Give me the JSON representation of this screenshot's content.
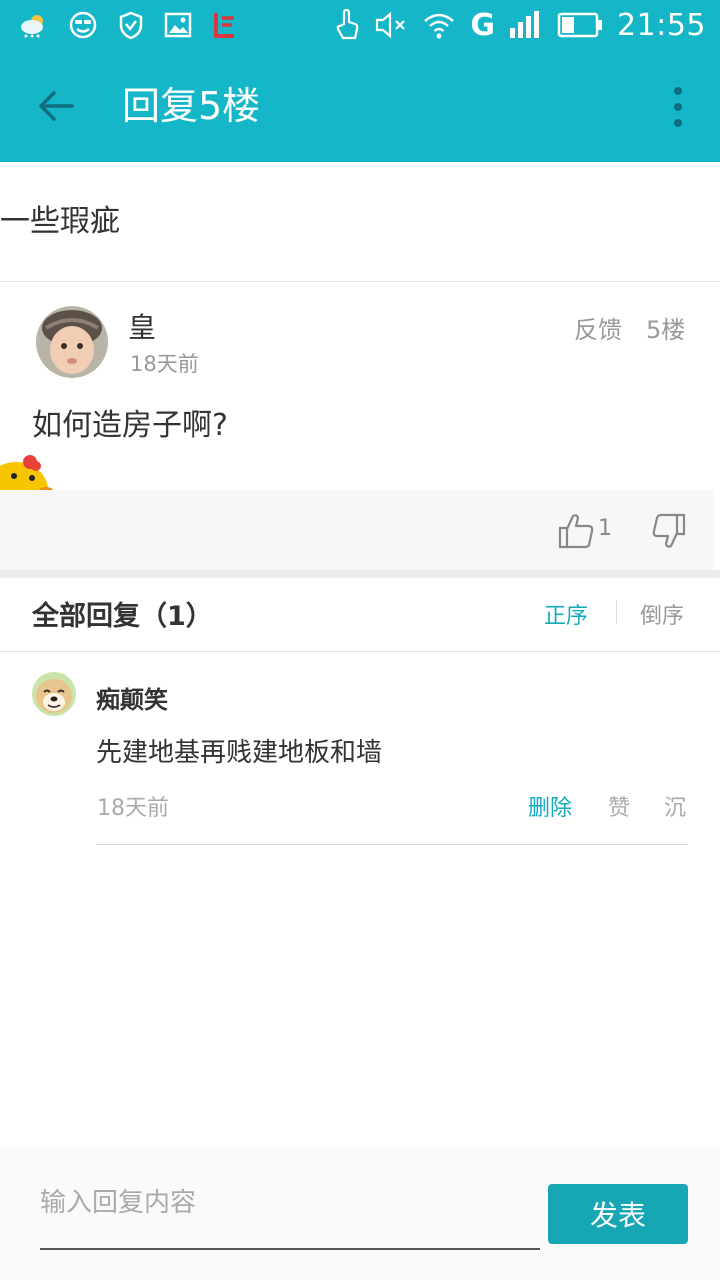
{
  "status_bar": {
    "time": "21:55",
    "network_label": "G",
    "icons_left": [
      "weather-icon",
      "smiley-icon",
      "shield-icon",
      "image-icon",
      "le-logo-icon"
    ],
    "icons_right": [
      "touch-icon",
      "mute-icon",
      "wifi-icon",
      "signal-icon",
      "battery-icon"
    ]
  },
  "appbar": {
    "title": "回复5楼",
    "back_icon": "back-arrow-icon",
    "more_icon": "more-vert-icon"
  },
  "quote": {
    "text": "一些瑕疵"
  },
  "post": {
    "author": "皇",
    "time": "18天前",
    "feedback_label": "反馈",
    "floor_label": "5楼",
    "content": "如何造房子啊?",
    "like_count": "1"
  },
  "replies_header": {
    "title": "全部回复（1）",
    "sort_asc": "正序",
    "sort_desc": "倒序"
  },
  "replies": [
    {
      "author": "痴颠笑",
      "content": "先建地基再贱建地板和墙",
      "time": "18天前",
      "delete_label": "删除",
      "like_label": "赞",
      "sink_label": "沉"
    }
  ],
  "composer": {
    "placeholder": "输入回复内容",
    "value": "",
    "send_label": "发表"
  },
  "colors": {
    "primary": "#14b6c8",
    "accent_text": "#14a9bd",
    "send_button": "#17a6b4"
  }
}
